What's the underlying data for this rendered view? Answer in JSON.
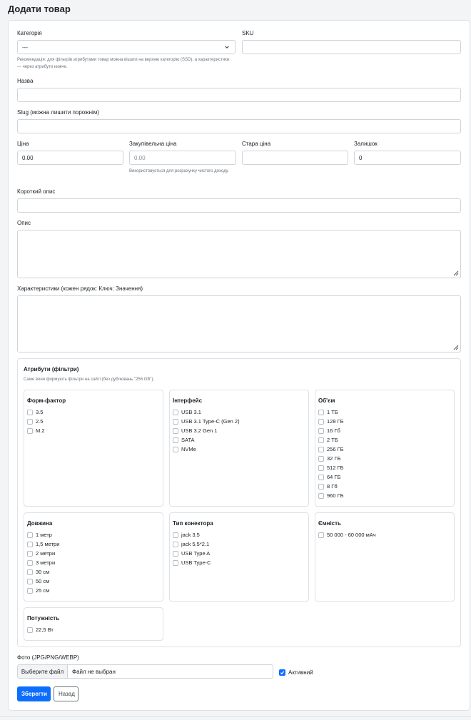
{
  "page": {
    "title": "Додати товар"
  },
  "form": {
    "category": {
      "label": "Категорія",
      "value": "---",
      "help": "Рекомендація: для фільтрів атрибутами товар можна вішати на верхню категорію (SSD), а характеристики — через атрибути нижче."
    },
    "sku": {
      "label": "SKU",
      "value": ""
    },
    "name": {
      "label": "Назва",
      "value": ""
    },
    "slug": {
      "label": "Slug (можна лишити порожнім)",
      "value": ""
    },
    "price": {
      "label": "Ціна",
      "value": "0.00"
    },
    "purchase_price": {
      "label": "Закупівельна ціна",
      "placeholder": "0.00",
      "help": "Використовується для розрахунку чистого доходу."
    },
    "old_price": {
      "label": "Стара ціна",
      "value": ""
    },
    "stock": {
      "label": "Залишок",
      "value": "0"
    },
    "short_description": {
      "label": "Короткий опис",
      "value": ""
    },
    "description": {
      "label": "Опис",
      "value": ""
    },
    "specs": {
      "label": "Характеристики (кожен рядок: Ключ: Значення)",
      "value": ""
    },
    "photo": {
      "label": "Фото (JPG/PNG/WEBP)",
      "button": "Выберите файл",
      "filename": "Файл не выбран"
    },
    "active": {
      "label": "Активний",
      "checked": true
    },
    "save_label": "Зберегти",
    "back_label": "Назад"
  },
  "attributes": {
    "title": "Атрибути (фільтри)",
    "help": "Саме вони формують фільтри на сайті (без дублювань \"256 GB\").",
    "groups": [
      {
        "title": "Форм-фактор",
        "options": [
          "3.5",
          "2.5",
          "M.2"
        ]
      },
      {
        "title": "Інтерфейс",
        "options": [
          "USB 3.1",
          "USB 3.1 Type-C (Gen 2)",
          "USB 3.2 Gen 1",
          "SATA",
          "NVMe"
        ]
      },
      {
        "title": "Об'єм",
        "options": [
          "1 ТБ",
          "128 ГБ",
          "16 Гб",
          "2 ТБ",
          "256 ГБ",
          "32 ГБ",
          "512 ГБ",
          "64 ГБ",
          "8 Гб",
          "960 ГБ"
        ]
      },
      {
        "title": "Довжина",
        "options": [
          "1 метр",
          "1,5 метри",
          "2 метри",
          "3 метри",
          "30 см",
          "50 см",
          "25 см"
        ]
      },
      {
        "title": "Тип конектора",
        "options": [
          "jack 3.5",
          "jack 5.5*2.1",
          "USB Type A",
          "USB Type-C"
        ]
      },
      {
        "title": "Ємність",
        "options": [
          "50 000 - 60 000 мАч"
        ]
      },
      {
        "title": "Потужність",
        "options": [
          "22,5 Вт"
        ]
      }
    ]
  }
}
